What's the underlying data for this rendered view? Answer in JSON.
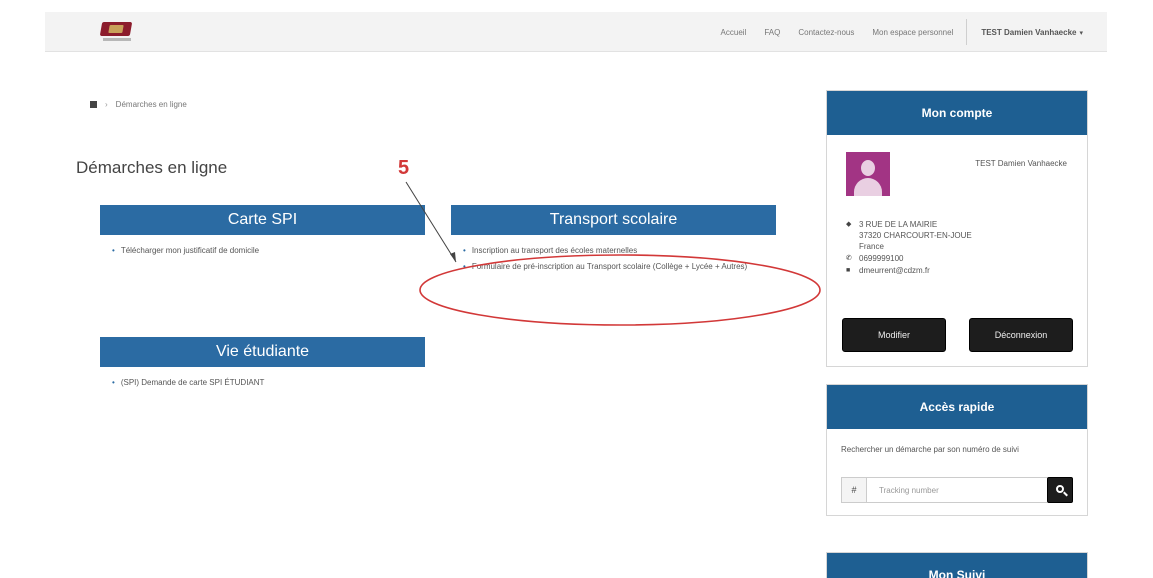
{
  "header": {
    "nav": [
      "Accueil",
      "FAQ",
      "Contactez-nous",
      "Mon espace personnel"
    ],
    "user_menu": "TEST Damien Vanhaecke"
  },
  "breadcrumb": {
    "current": "Démarches en ligne"
  },
  "page_title": "Démarches en ligne",
  "sections": [
    {
      "title": "Carte SPI",
      "links": [
        "Télécharger mon justificatif de domicile"
      ]
    },
    {
      "title": "Transport scolaire",
      "links": [
        "Inscription au transport des écoles maternelles",
        "Formulaire de pré-inscription au Transport scolaire (Collège + Lycée + Autres)"
      ]
    },
    {
      "title": "Vie étudiante",
      "links": [
        "(SPI) Demande de carte SPI ÉTUDIANT"
      ]
    }
  ],
  "annotation": {
    "number": "5",
    "color": "#d23838"
  },
  "account": {
    "title": "Mon compte",
    "name": "TEST Damien Vanhaecke",
    "address_line1": "3 RUE DE LA MAIRIE",
    "address_line2": "37320 CHARCOURT-EN-JOUE",
    "address_line3": "France",
    "phone": "0699999100",
    "email": "dmeurrent@cdzm.fr",
    "modify_label": "Modifier",
    "logout_label": "Déconnexion"
  },
  "quick_access": {
    "title": "Accès rapide",
    "text": "Rechercher un démarche par son numéro de suivi",
    "prefix": "#",
    "placeholder": "Tracking number"
  },
  "third_widget": {
    "title": "Mon Suivi"
  },
  "colors": {
    "section_header": "#2b6ba3",
    "widget_header": "#1e5f92",
    "button_dark": "#1d1d1d",
    "avatar": "#a23484"
  },
  "icons": [
    "home-icon",
    "map-marker-icon",
    "phone-icon",
    "envelope-icon",
    "search-icon",
    "caret-down-icon"
  ]
}
